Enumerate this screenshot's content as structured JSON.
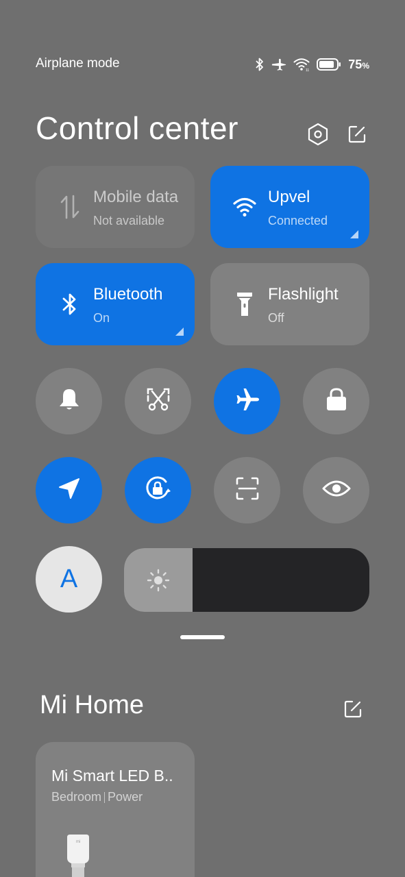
{
  "status_bar": {
    "mode_label": "Airplane mode",
    "battery_percent": "75",
    "battery_unit": "%",
    "icons": [
      "bluetooth-icon",
      "airplane-icon",
      "wifi-icon",
      "battery-icon"
    ]
  },
  "header": {
    "title": "Control center",
    "icons": [
      "settings-hexagon-icon",
      "edit-icon"
    ]
  },
  "tiles": [
    {
      "title": "Mobile data",
      "subtitle": "Not available",
      "icon": "mobile-data-icon",
      "state": "disabled"
    },
    {
      "title": "Upvel",
      "subtitle": "Connected",
      "icon": "wifi-icon",
      "state": "on"
    },
    {
      "title": "Bluetooth",
      "subtitle": "On",
      "icon": "bluetooth-icon",
      "state": "on"
    },
    {
      "title": "Flashlight",
      "subtitle": "Off",
      "icon": "flashlight-icon",
      "state": "off"
    }
  ],
  "toggles_row1": [
    {
      "icon": "bell-icon",
      "state": "off"
    },
    {
      "icon": "screenshot-scissors-icon",
      "state": "off"
    },
    {
      "icon": "airplane-icon",
      "state": "on"
    },
    {
      "icon": "lock-icon",
      "state": "off"
    }
  ],
  "toggles_row2": [
    {
      "icon": "location-icon",
      "state": "on"
    },
    {
      "icon": "rotation-lock-icon",
      "state": "on"
    },
    {
      "icon": "scan-icon",
      "state": "off"
    },
    {
      "icon": "eye-icon",
      "state": "off"
    }
  ],
  "auto_brightness": {
    "label": "A",
    "state": "on"
  },
  "brightness": {
    "level": 0.28,
    "icon": "sun-icon"
  },
  "mi_home": {
    "title": "Mi Home",
    "edit_icon": "edit-icon",
    "devices": [
      {
        "name": "Mi Smart LED B..",
        "room": "Bedroom",
        "status": "Power",
        "icon": "bulb-icon"
      }
    ]
  },
  "colors": {
    "background": "#6f6f6f",
    "tile": "#818181",
    "accent": "#0f73e3",
    "slider_track": "#242426",
    "slider_fill": "#9b9b9b"
  }
}
